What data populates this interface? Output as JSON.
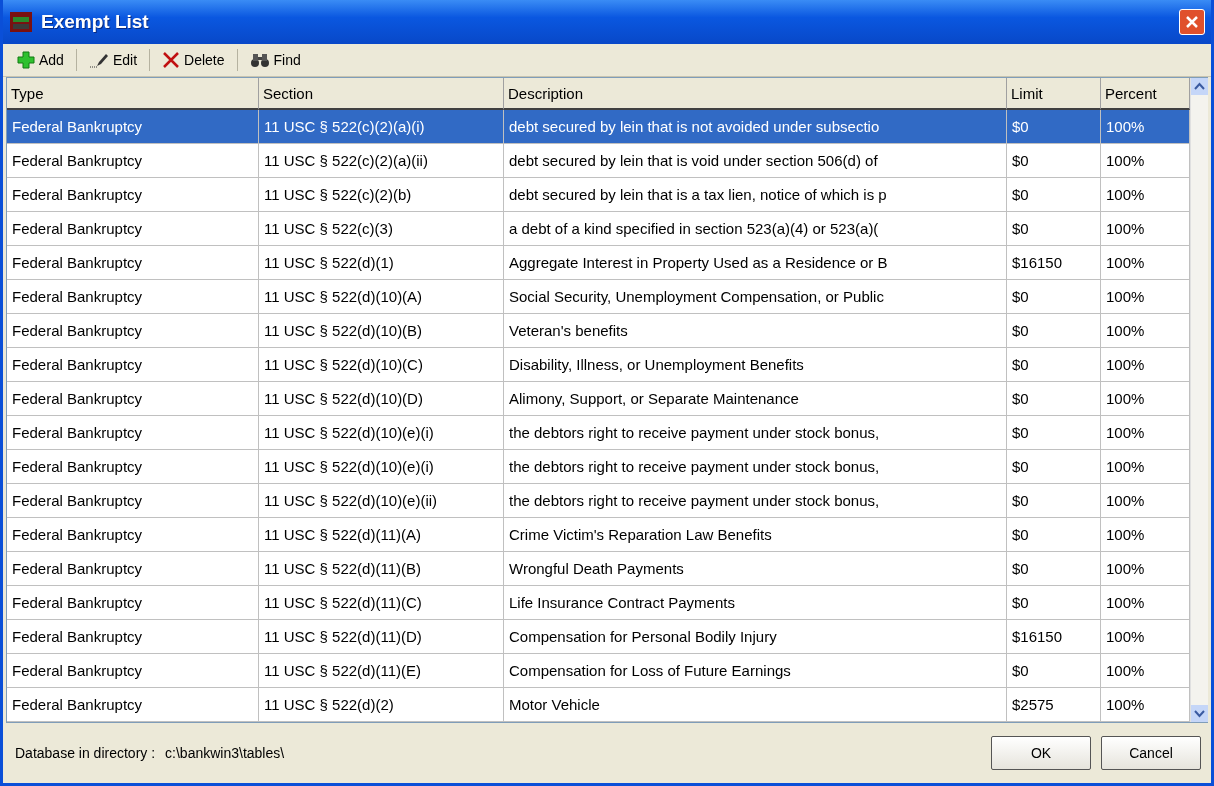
{
  "window": {
    "title": "Exempt List"
  },
  "toolbar": [
    {
      "kind": "add",
      "label": "Add"
    },
    {
      "kind": "edit",
      "label": "Edit"
    },
    {
      "kind": "delete",
      "label": "Delete"
    },
    {
      "kind": "find",
      "label": "Find"
    }
  ],
  "table": {
    "columns": [
      "Type",
      "Section",
      "Description",
      "Limit",
      "Percent"
    ],
    "rows": [
      {
        "selected": true,
        "cells": [
          "Federal Bankruptcy",
          "11 USC § 522(c)(2)(a)(i)",
          "debt secured by lein that is not avoided under subsectio",
          "$0",
          "100%"
        ]
      },
      {
        "selected": false,
        "cells": [
          "Federal Bankruptcy",
          "11 USC § 522(c)(2)(a)(ii)",
          "debt secured by lein that is void under section 506(d) of",
          "$0",
          "100%"
        ]
      },
      {
        "selected": false,
        "cells": [
          "Federal Bankruptcy",
          "11 USC § 522(c)(2)(b)",
          "debt secured by lein that is a tax lien, notice of which is p",
          "$0",
          "100%"
        ]
      },
      {
        "selected": false,
        "cells": [
          "Federal Bankruptcy",
          "11 USC § 522(c)(3)",
          "a debt of a kind specified in section 523(a)(4) or 523(a)(",
          "$0",
          "100%"
        ]
      },
      {
        "selected": false,
        "cells": [
          "Federal Bankruptcy",
          "11 USC § 522(d)(1)",
          "Aggregate Interest in Property Used as a Residence or B",
          "$16150",
          "100%"
        ]
      },
      {
        "selected": false,
        "cells": [
          "Federal Bankruptcy",
          "11 USC § 522(d)(10)(A)",
          "Social Security, Unemployment Compensation, or Public",
          "$0",
          "100%"
        ]
      },
      {
        "selected": false,
        "cells": [
          "Federal Bankruptcy",
          "11 USC § 522(d)(10)(B)",
          "Veteran's benefits",
          "$0",
          "100%"
        ]
      },
      {
        "selected": false,
        "cells": [
          "Federal Bankruptcy",
          "11 USC § 522(d)(10)(C)",
          "Disability, Illness, or Unemployment Benefits",
          "$0",
          "100%"
        ]
      },
      {
        "selected": false,
        "cells": [
          "Federal Bankruptcy",
          "11 USC § 522(d)(10)(D)",
          "Alimony, Support, or Separate Maintenance",
          "$0",
          "100%"
        ]
      },
      {
        "selected": false,
        "cells": [
          "Federal Bankruptcy",
          "11 USC § 522(d)(10)(e)(i)",
          "the debtors right to receive payment under stock bonus,",
          "$0",
          "100%"
        ]
      },
      {
        "selected": false,
        "cells": [
          "Federal Bankruptcy",
          "11 USC § 522(d)(10)(e)(i)",
          "the debtors right to receive payment under stock bonus,",
          "$0",
          "100%"
        ]
      },
      {
        "selected": false,
        "cells": [
          "Federal Bankruptcy",
          "11 USC § 522(d)(10)(e)(ii)",
          "the debtors right to receive payment under stock bonus,",
          "$0",
          "100%"
        ]
      },
      {
        "selected": false,
        "cells": [
          "Federal Bankruptcy",
          "11 USC § 522(d)(11)(A)",
          "Crime Victim's Reparation Law Benefits",
          "$0",
          "100%"
        ]
      },
      {
        "selected": false,
        "cells": [
          "Federal Bankruptcy",
          "11 USC § 522(d)(11)(B)",
          "Wrongful Death Payments",
          "$0",
          "100%"
        ]
      },
      {
        "selected": false,
        "cells": [
          "Federal Bankruptcy",
          "11 USC § 522(d)(11)(C)",
          "Life Insurance Contract Payments",
          "$0",
          "100%"
        ]
      },
      {
        "selected": false,
        "cells": [
          "Federal Bankruptcy",
          "11 USC § 522(d)(11)(D)",
          "Compensation for Personal Bodily Injury",
          "$16150",
          "100%"
        ]
      },
      {
        "selected": false,
        "cells": [
          "Federal Bankruptcy",
          "11 USC § 522(d)(11)(E)",
          "Compensation for Loss of Future Earnings",
          "$0",
          "100%"
        ]
      },
      {
        "selected": false,
        "cells": [
          "Federal Bankruptcy",
          "11 USC § 522(d)(2)",
          "Motor Vehicle",
          "$2575",
          "100%"
        ]
      }
    ]
  },
  "status": {
    "label": "Database in directory :",
    "path": "c:\\bankwin3\\tables\\"
  },
  "buttons": [
    "OK",
    "Cancel"
  ]
}
